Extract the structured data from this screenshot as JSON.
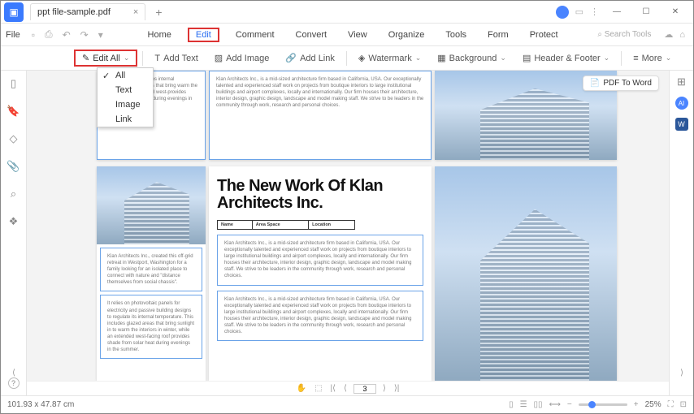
{
  "titlebar": {
    "tab_name": "ppt file-sample.pdf"
  },
  "menubar": {
    "file": "File",
    "items": [
      "Home",
      "Edit",
      "Comment",
      "Convert",
      "View",
      "Organize",
      "Tools",
      "Form",
      "Protect"
    ],
    "active_index": 1,
    "search_placeholder": "Search Tools"
  },
  "toolbar": {
    "edit_all": "Edit All",
    "add_text": "Add Text",
    "add_image": "Add Image",
    "add_link": "Add Link",
    "watermark": "Watermark",
    "background": "Background",
    "header_footer": "Header & Footer",
    "more": "More"
  },
  "dropdown": {
    "items": [
      "All",
      "Text",
      "Image",
      "Link"
    ],
    "checked_index": 0
  },
  "pdf_to_word": "PDF To Word",
  "document": {
    "heading": "The New Work Of Klan Architects Inc.",
    "table": {
      "c1_label": "Name",
      "c1_val": "",
      "c2_label": "Area Space",
      "c2_val": "",
      "c3_label": "Location",
      "c3_val": ""
    },
    "para_company": "Klan Architects Inc., is a mid-sized architecture firm based in California, USA. Our exceptionally talented and experienced staff work on projects from boutique interiors to large institutional buildings and airport complexes, locally and internationally. Our firm houses their architecture, interior design, graphic design, landscape and model making staff. We strive to be leaders in the community through work, research and personal choices.",
    "para_left1": "passive building designs internal temperature This areas that bring warm the interiors in an extended west-provides shade from solar heat during evenings in the summer",
    "para_left2": "Klan Architects Inc., created this off-grid retreat in Westport, Washington for a family looking for an isolated place to connect with nature and \"distance themselves from social chassis\".",
    "para_left3": "It relies on photovoltaic panels for electricity and passive building designs to regulate its internal temperature. This includes glazed areas that bring sunlight in to warm the interiors in winter, while an extended west-facing roof provides shade from solar heat during evenings in the summer."
  },
  "pager": {
    "current_page": "3"
  },
  "statusbar": {
    "dimensions": "101.93 x 47.87 cm",
    "zoom": "25%"
  }
}
